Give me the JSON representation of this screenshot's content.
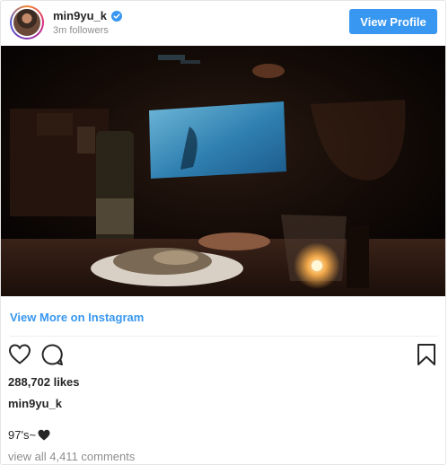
{
  "header": {
    "username": "min9yu_k",
    "followers": "3m followers",
    "view_profile_label": "View Profile"
  },
  "icons": {
    "avatar": "avatar",
    "verified": "verified-badge-icon",
    "like": "heart-outline-icon",
    "comment": "comment-bubble-icon",
    "save": "bookmark-icon",
    "caption_emoji": "black-heart-icon"
  },
  "colors": {
    "accent": "#3897f0",
    "text": "#262626",
    "muted": "#8e8e8e"
  },
  "link": {
    "view_more_label": "View More on Instagram"
  },
  "post": {
    "likes": "288,702 likes",
    "caption_user": "min9yu_k",
    "caption_text": "97's~",
    "comments_label": "view all 4,411 comments"
  }
}
